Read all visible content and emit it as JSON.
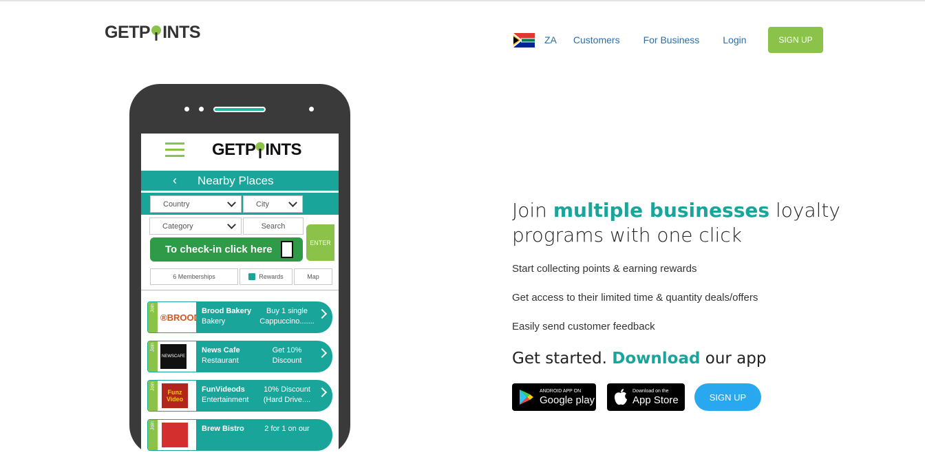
{
  "header": {
    "logo_text_left": "GETP",
    "logo_text_right": "INTS",
    "country_code": "ZA",
    "nav": [
      "Customers",
      "For Business",
      "Login"
    ],
    "signup_label": "SIGN UP"
  },
  "phone": {
    "app_logo_left": "GETP",
    "app_logo_right": "INTS",
    "screen_title": "Nearby Places",
    "filters": {
      "country": "Country",
      "city": "City",
      "category": "Category",
      "search": "Search"
    },
    "enter_label": "ENTER",
    "checkin_label": "To check-in click here",
    "tabs": [
      "6 Memberships",
      "Rewards",
      "Map"
    ],
    "join_label": "Join",
    "places": [
      {
        "name": "Brood Bakery",
        "category": "Bakery",
        "deal_line1": "Buy 1 single",
        "deal_line2": "Cappuccino.......",
        "logo": "®BROOD"
      },
      {
        "name": "News Cafe",
        "category": "Restaurant",
        "deal_line1": "Get 10%",
        "deal_line2": "Discount",
        "logo": "NEWSCAFE"
      },
      {
        "name": "FunVideods",
        "category": "Entertainment",
        "deal_line1": "10% Discount",
        "deal_line2": "(Hard Drive....",
        "logo": "Funz Video"
      },
      {
        "name": "Brew Bistro",
        "category": "",
        "deal_line1": "2 for 1 on our",
        "deal_line2": "",
        "logo": ""
      }
    ]
  },
  "hero": {
    "heading_pre": "Join ",
    "heading_highlight": "multiple businesses",
    "heading_post": " loyalty programs with one click",
    "features": [
      "Start collecting points & earning rewards",
      "Get access to their limited time & quantity deals/offers",
      "Easily send customer feedback"
    ],
    "get_started_pre": "Get started. ",
    "get_started_highlight": "Download",
    "get_started_post": " our app",
    "google_play_small": "ANDROID APP ON",
    "google_play_big": "Google play",
    "app_store_small": "Download on the",
    "app_store_big": "App Store",
    "signup_label": "SIGN UP"
  },
  "colors": {
    "teal": "#19a59a",
    "green": "#8bc34a",
    "link_blue": "#2e6da4",
    "signup_blue": "#29a8f0",
    "phone_body": "#3a3a3a"
  }
}
